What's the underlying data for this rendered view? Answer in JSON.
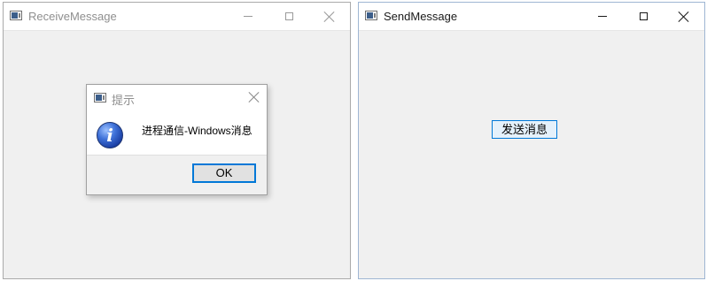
{
  "receive_window": {
    "title": "ReceiveMessage",
    "state": "inactive"
  },
  "send_window": {
    "title": "SendMessage",
    "state": "active",
    "send_button_label": "发送消息"
  },
  "message_box": {
    "title": "提示",
    "text": "进程通信-Windows消息",
    "ok_label": "OK",
    "icon": "information-icon"
  },
  "icons": {
    "app": "app-window-icon",
    "minimize": "minimize-icon",
    "maximize": "maximize-icon",
    "close": "close-icon",
    "info_glyph": "i"
  },
  "colors": {
    "focus_blue": "#0078d7",
    "window_bg": "#f0f0f0"
  }
}
